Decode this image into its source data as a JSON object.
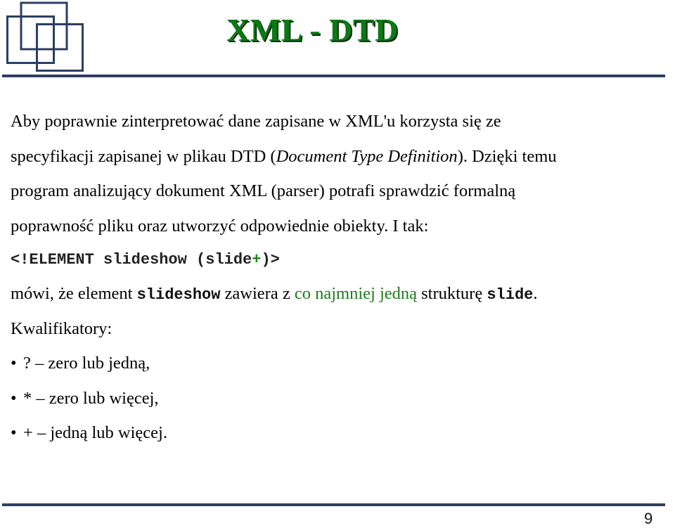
{
  "slide": {
    "title": "XML - DTD",
    "page_number": "9",
    "colors": {
      "title": "#0a7a14",
      "rule": "#2c3e63",
      "logo": "#2c3e63",
      "highlight": "#1f7a1f"
    }
  },
  "logo": {
    "icon": "overlapping-squares-logo"
  },
  "body": {
    "paragraph": {
      "line1": "Aby poprawnie zinterpretować dane zapisane w XML'u korzysta się ze",
      "line2_pre": "specyfikacji  zapisanej w plikau DTD (",
      "line2_italic": "Document Type Definition",
      "line2_post": "). Dzięki temu",
      "line3": "program analizujący dokument XML (parser) potrafi sprawdzić formalną",
      "line4": "poprawność pliku oraz utworzyć odpowiednie obiekty. I tak:"
    },
    "code": {
      "pre": "<!ELEMENT slideshow (slide",
      "plus": "+",
      "post": ")>"
    },
    "explanation": {
      "pre": "mówi, że element ",
      "code1": "slideshow",
      "mid": " zawiera z ",
      "highlight": "co najmniej jedną",
      "post": " strukturę ",
      "code2": "slide",
      "end": "."
    },
    "qualifiers_label": "Kwalifikatory:",
    "qualifiers": [
      {
        "bullet": "•",
        "text": "? – zero lub jedną,"
      },
      {
        "bullet": "•",
        "text": "* – zero lub więcej,"
      },
      {
        "bullet": "•",
        "text": "+ – jedną lub więcej."
      }
    ]
  }
}
